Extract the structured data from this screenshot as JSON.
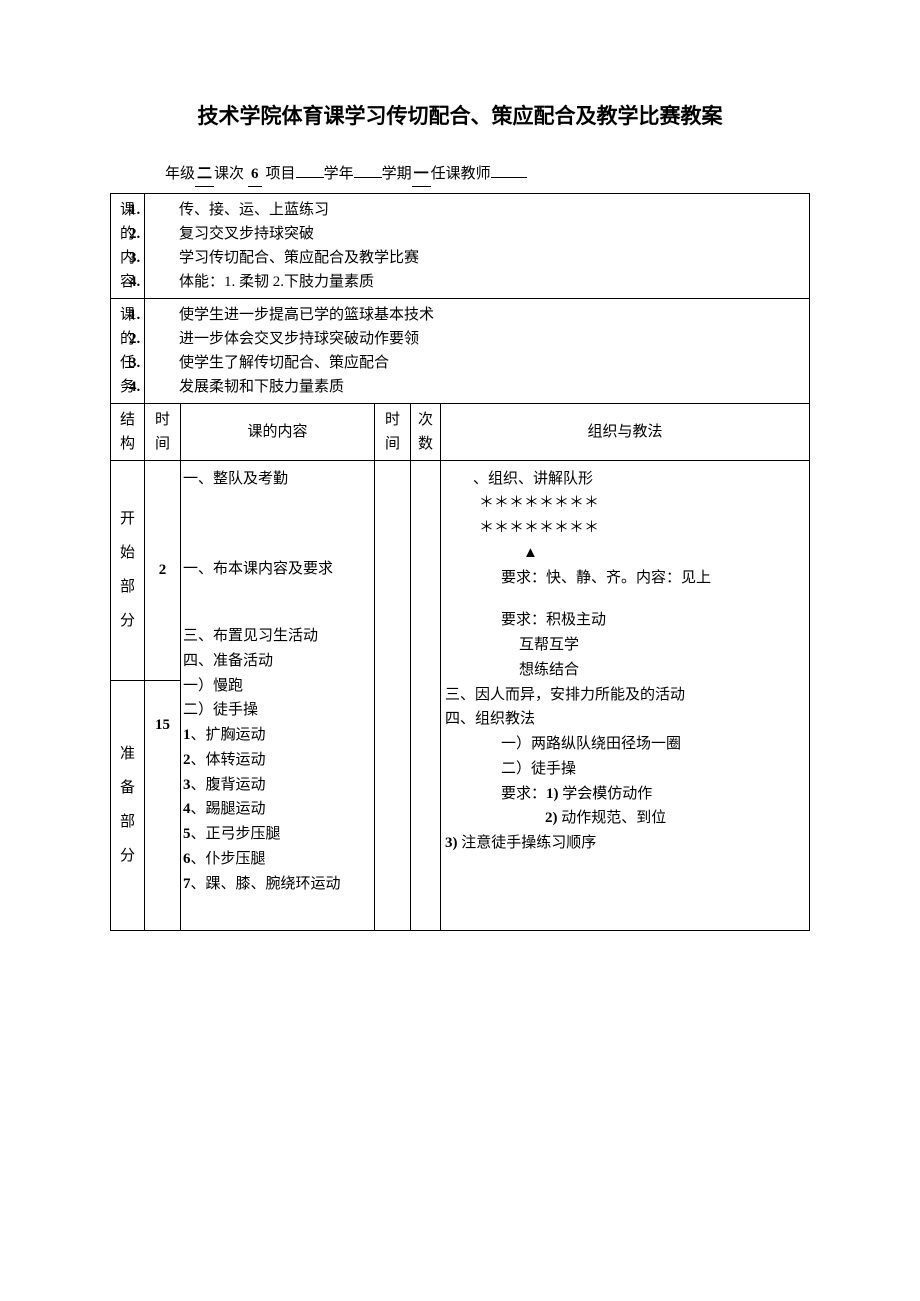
{
  "title": "技术学院体育课学习传切配合、策应配合及教学比赛教案",
  "meta": {
    "grade_label": "年级",
    "grade_value": "二",
    "lesson_label": "课次",
    "lesson_value": "6",
    "project_label": "项目",
    "year_label": "学年",
    "term_label": "学期",
    "term_value": "一",
    "teacher_label": "任课教师"
  },
  "row1": {
    "label_c1": "课",
    "label_c2": "的",
    "label_c3": "内",
    "label_c4": "容",
    "items": [
      "传、接、运、上蓝练习",
      "复习交叉步持球突破",
      "学习传切配合、策应配合及教学比赛",
      "体能：1. 柔韧 2.下肢力量素质"
    ]
  },
  "row2": {
    "label_c1": "课",
    "label_c2": "的",
    "label_c3": "任",
    "label_c4": "务",
    "items": [
      "使学生进一步提高已学的篮球基本技术",
      "进一步体会交叉步持球突破动作要领",
      "使学生了解传切配合、策应配合",
      "发展柔韧和下肢力量素质"
    ]
  },
  "headers": {
    "struct": "结构",
    "time_a": "时间",
    "content": "课的内容",
    "time_b": "时间",
    "count_c1": "次",
    "count_c2": "数",
    "method": "组织与教法"
  },
  "section1": {
    "label_c1": "开",
    "label_c2": "始",
    "label_c3": "部",
    "label_c4": "分",
    "time": "2",
    "content_l1": "一、整队及考勤",
    "content_l2": "一、布本课内容及要求",
    "content_l3": "三、布置见习生活动",
    "content_l4": "四、准备活动",
    "content_l5": "一）慢跑",
    "content_l6": "二）徒手操",
    "content_l7": "1、扩胸运动",
    "content_l8": "2、体转运动",
    "content_l9": "3、腹背运动",
    "content_l10": "4、踢腿运动",
    "content_l11": "5、正弓步压腿",
    "content_l12": "6、仆步压腿",
    "content_l13": "7、踝、膝、腕绕环运动",
    "method_l1": "、组织、讲解队形",
    "method_l2": "＊＊＊＊＊＊＊＊",
    "method_l3": "＊＊＊＊＊＊＊＊",
    "method_l4": "▲",
    "method_l5": "要求：快、静、齐。内容：见上",
    "method_l6": "要求：积极主动",
    "method_l7": "互帮互学",
    "method_l8": "想练结合",
    "method_l9": "三、因人而异，安排力所能及的活动",
    "method_l10": "四、组织教法",
    "method_l11": "一）两路纵队绕田径场一圈",
    "method_l12": "二）徒手操",
    "method_l13": "要求：1）学会模仿动作",
    "method_l14": "2）动作规范、到位",
    "method_l15": "3）注意徒手操练习顺序"
  },
  "section2": {
    "label_c1": "准",
    "label_c2": "备",
    "label_c3": "部",
    "label_c4": "分",
    "time": "15"
  }
}
